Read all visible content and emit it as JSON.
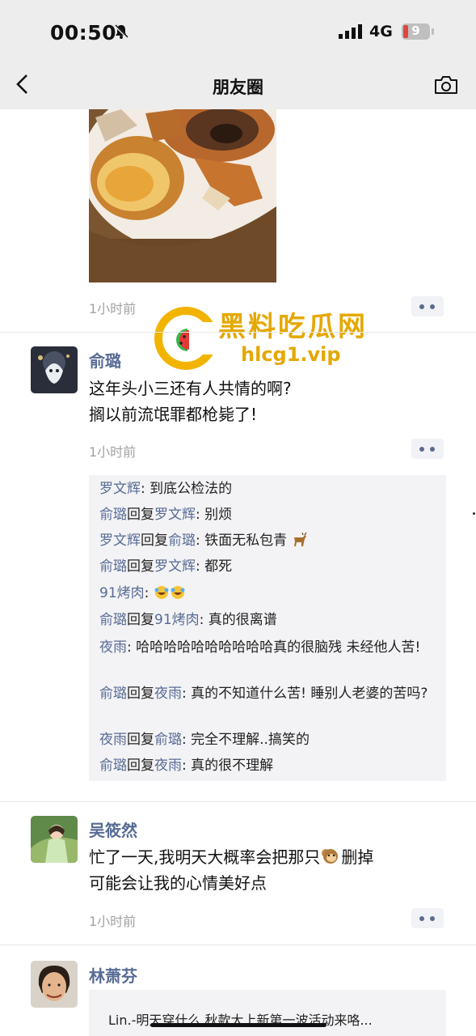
{
  "status": {
    "time": "00:50",
    "network": "4G",
    "battery": "9"
  },
  "nav": {
    "title": "朋友圈"
  },
  "post0": {
    "time": "1小时前"
  },
  "watermark": {
    "title": "黑料吃瓜网",
    "url": "hlcg1.vip"
  },
  "post1": {
    "author": "俞璐",
    "lines": [
      "这年头小三还有人共情的啊?",
      "搁以前流氓罪都枪毙了!"
    ],
    "time": "1小时前",
    "comments": [
      {
        "from": "罗文辉",
        "to": "",
        "text": "到底公检法的"
      },
      {
        "from": "俞璐",
        "to": "罗文辉",
        "text": "别烦"
      },
      {
        "from": "罗文辉",
        "to": "俞璐",
        "text": "铁面无私包青"
      },
      {
        "from": "俞璐",
        "to": "罗文辉",
        "text": "都死"
      },
      {
        "from": "91烤肉",
        "to": "",
        "text": ""
      },
      {
        "from": "俞璐",
        "to": "91烤肉",
        "text": "真的很离谱"
      },
      {
        "from": "夜雨",
        "to": "",
        "text": "哈哈哈哈哈哈哈哈哈哈真的很脑残 未经他人苦!"
      },
      {
        "from": "俞璐",
        "to": "夜雨",
        "text": "真的不知道什么苦! 睡别人老婆的苦吗?"
      },
      {
        "from": "夜雨",
        "to": "俞璐",
        "text": "完全不理解..搞笑的"
      },
      {
        "from": "俞璐",
        "to": "夜雨",
        "text": "真的很不理解"
      }
    ],
    "reply_word": "回复",
    "colon": ": "
  },
  "post2": {
    "author": "吴筱然",
    "line1a": "忙了一天,我明天大概率会把那只",
    "line1b": "删掉",
    "line2": "可能会让我的心情美好点",
    "time": "1小时前"
  },
  "post3": {
    "author": "林萧芬",
    "shared": "Lin.-明天穿什么 秋款大上新第一波活动来咯..."
  },
  "colors": {
    "link": "#576b95",
    "bar": "#ededed",
    "watermark": "#e4a800"
  }
}
